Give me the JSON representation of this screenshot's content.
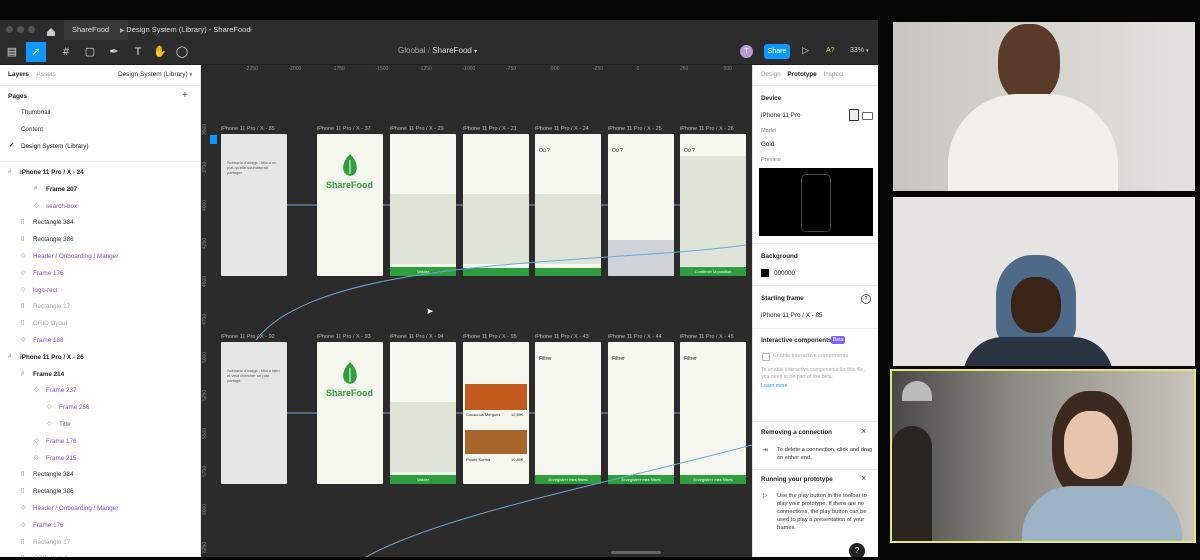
{
  "browser": {
    "tabs": [
      {
        "label": "ShareFood"
      },
      {
        "label": "Design System (Library) - ShareFood"
      }
    ],
    "new_tab_symbol": "+"
  },
  "toolbar": {
    "breadcrumb_parent": "Gloobal",
    "breadcrumb_sep": "/",
    "breadcrumb_current": "ShareFood",
    "avatar_letter": "T",
    "share_label": "Share",
    "font_tag": "A?",
    "zoom": "33%"
  },
  "left_panel": {
    "tabs": [
      "Layers",
      "Assets"
    ],
    "library_label": "Design System (Library)",
    "pages_title": "Pages",
    "pages": [
      "Thumbnail",
      "Content",
      "Design System (Library)"
    ],
    "layers": [
      {
        "label": "iPhone 11 Pro / X - 24",
        "type": "frame"
      },
      {
        "label": "Frame 207",
        "type": "frame"
      },
      {
        "label": "search-box",
        "type": "component"
      },
      {
        "label": "Rectangle 384",
        "type": "rect"
      },
      {
        "label": "Rectangle 386",
        "type": "rect"
      },
      {
        "label": "Header / Onboarding / Manger",
        "type": "component"
      },
      {
        "label": "Frame 176",
        "type": "component"
      },
      {
        "label": "logo-rect",
        "type": "component"
      },
      {
        "label": "Rectangle 17",
        "type": "muted"
      },
      {
        "label": "GRID layout",
        "type": "muted"
      },
      {
        "label": "Frame 188",
        "type": "component"
      },
      {
        "label": "iPhone 11 Pro / X - 26",
        "type": "frame"
      },
      {
        "label": "Frame 214",
        "type": "frame"
      },
      {
        "label": "Frame 237",
        "type": "component"
      },
      {
        "label": "Frame 256",
        "type": "component"
      },
      {
        "label": "Title",
        "type": "component"
      },
      {
        "label": "Frame 176",
        "type": "component"
      },
      {
        "label": "Frame 215",
        "type": "component"
      },
      {
        "label": "Rectangle 384",
        "type": "rect"
      },
      {
        "label": "Rectangle 386",
        "type": "rect"
      },
      {
        "label": "Header / Onboarding / Manger",
        "type": "component"
      },
      {
        "label": "Frame 176",
        "type": "component"
      },
      {
        "label": "Rectangle 17",
        "type": "muted"
      },
      {
        "label": "GRID layout",
        "type": "muted"
      }
    ]
  },
  "canvas": {
    "ruler_ticks": [
      "-2250",
      "-2000",
      "-1750",
      "-1500",
      "-1250",
      "-1000",
      "-750",
      "-500",
      "-250",
      "0",
      "250",
      "500"
    ],
    "row1_labels": [
      "iPhone 11 Pro / X - 85",
      "iPhone 11 Pro / X - 37",
      "iPhone 11 Pro / X - 29",
      "iPhone 11 Pro / X - 21",
      "iPhone 11 Pro / X - 24",
      "iPhone 11 Pro / X - 25",
      "iPhone 11 Pro / X - 26"
    ],
    "row2_labels": [
      "iPhone 11 Pro / X - 92",
      "iPhone 11 Pro / X - 93",
      "iPhone 11 Pro / X - 94",
      "iPhone 11 Pro / X - 95",
      "iPhone 11 Pro / X - 43",
      "iPhone 11 Pro / X - 44",
      "iPhone 11 Pro / X - 45"
    ],
    "brand": "ShareFood",
    "validate_btn": "Valider",
    "confirm_btn": "Confirmer la position",
    "filter_btn": "Enregistrer mes filtres",
    "frame85_text": "Scénario d'usage : Mia a un plat qu'elle souhaiterait partager.",
    "frame92_text": "Scénario d'usage : Mia a faim et veut chercher un plat partagé.",
    "where_label": "Où ?",
    "filters_title": "Filtrer",
    "dish1": "Couscous Merguez",
    "dish1_price": "12,50€",
    "dish2": "Poulet Korma",
    "dish2_price": "10,80€",
    "ruler_left_ticks": [
      "3500",
      "3750",
      "4000",
      "4250",
      "4500",
      "4750",
      "5000",
      "5250",
      "5500",
      "5750",
      "6000",
      "6250"
    ]
  },
  "right_panel": {
    "tabs": [
      "Design",
      "Prototype",
      "Inspect"
    ],
    "device_title": "Device",
    "device_name": "iPhone 11 Pro",
    "model_label": "Model",
    "model_value": "Gold",
    "preview_label": "Preview",
    "background_title": "Background",
    "background_value": "000000",
    "starting_frame_title": "Starting frame",
    "starting_frame_value": "iPhone 11 Pro / X - 85",
    "interactive_title": "Interactive components",
    "beta_badge": "Beta",
    "enable_label": "Enable interactive components",
    "enable_desc": "To enable interactive components for this file, you need to be part of the beta.",
    "learn_more": "Learn more",
    "remove_title": "Removing a connection",
    "remove_desc": "To delete a connection, click and drag on either end.",
    "running_title": "Running your prototype",
    "running_desc": "Use the play button in the toolbar to play your prototype. If there are no connections, the play button can be used to play a presentation of your frames.",
    "help": "?"
  },
  "colors": {
    "brand_green": "#2e9e3f",
    "accent_blue": "#0d99ff",
    "video_border": "#e8e86a"
  }
}
